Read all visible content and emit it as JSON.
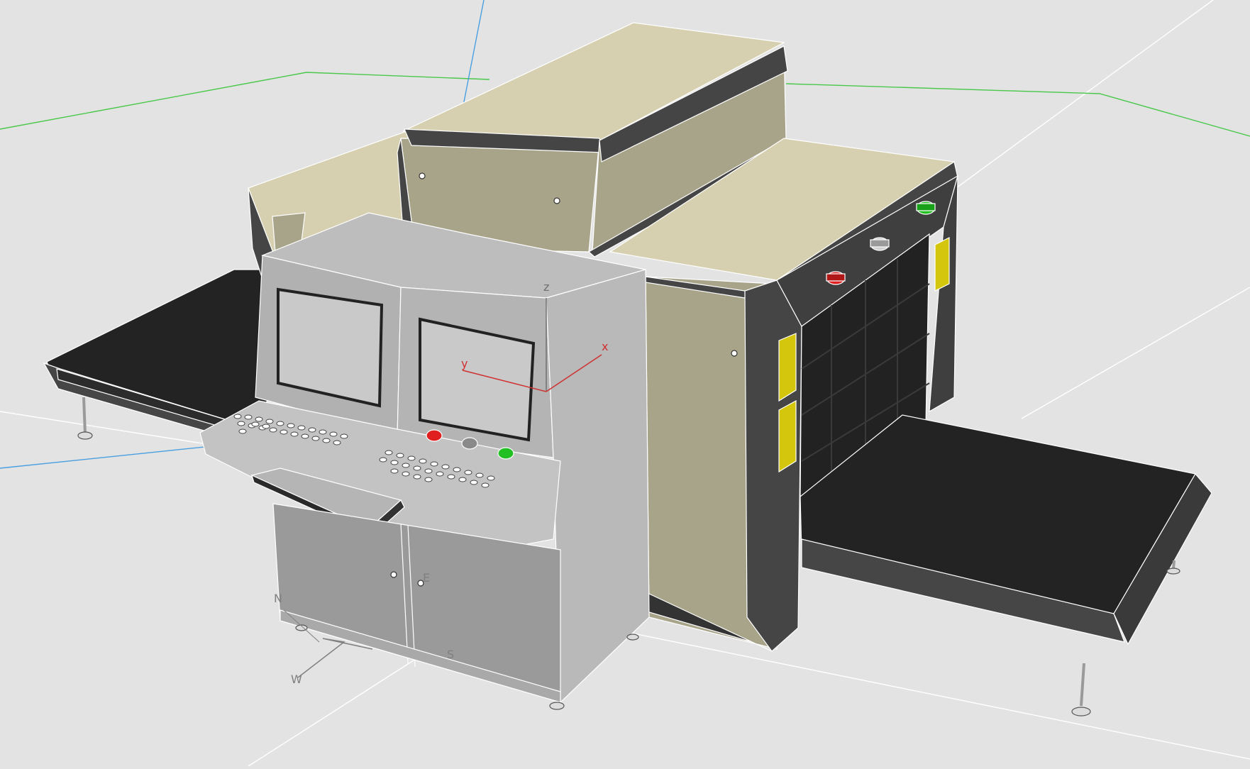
{
  "viewport": {
    "background": "#e3e3e3",
    "grid_color": "#ffffff",
    "wire_color": "#ffffff"
  },
  "gizmo": {
    "axis_x": "x",
    "axis_y": "y",
    "axis_z": "z",
    "x_color": "#d03030",
    "y_color": "#d03030",
    "z_color": "#707070"
  },
  "compass": {
    "north": "N",
    "east": "E",
    "south": "S",
    "west": "W"
  },
  "axes_lines": {
    "green": "#49c84a",
    "blue": "#4a9fe0"
  },
  "materials": {
    "housing_beige": "#d6d0b0",
    "housing_shadow": "#a8a48a",
    "housing_trim": "#454545",
    "console_gray": "#b9b9b9",
    "belt_black": "#232323",
    "warning_yellow": "#d4c60c"
  },
  "indicator_lights": [
    {
      "name": "red",
      "color": "#e02020"
    },
    {
      "name": "gray",
      "color": "#8a8a8a"
    },
    {
      "name": "green",
      "color": "#22c022"
    }
  ]
}
